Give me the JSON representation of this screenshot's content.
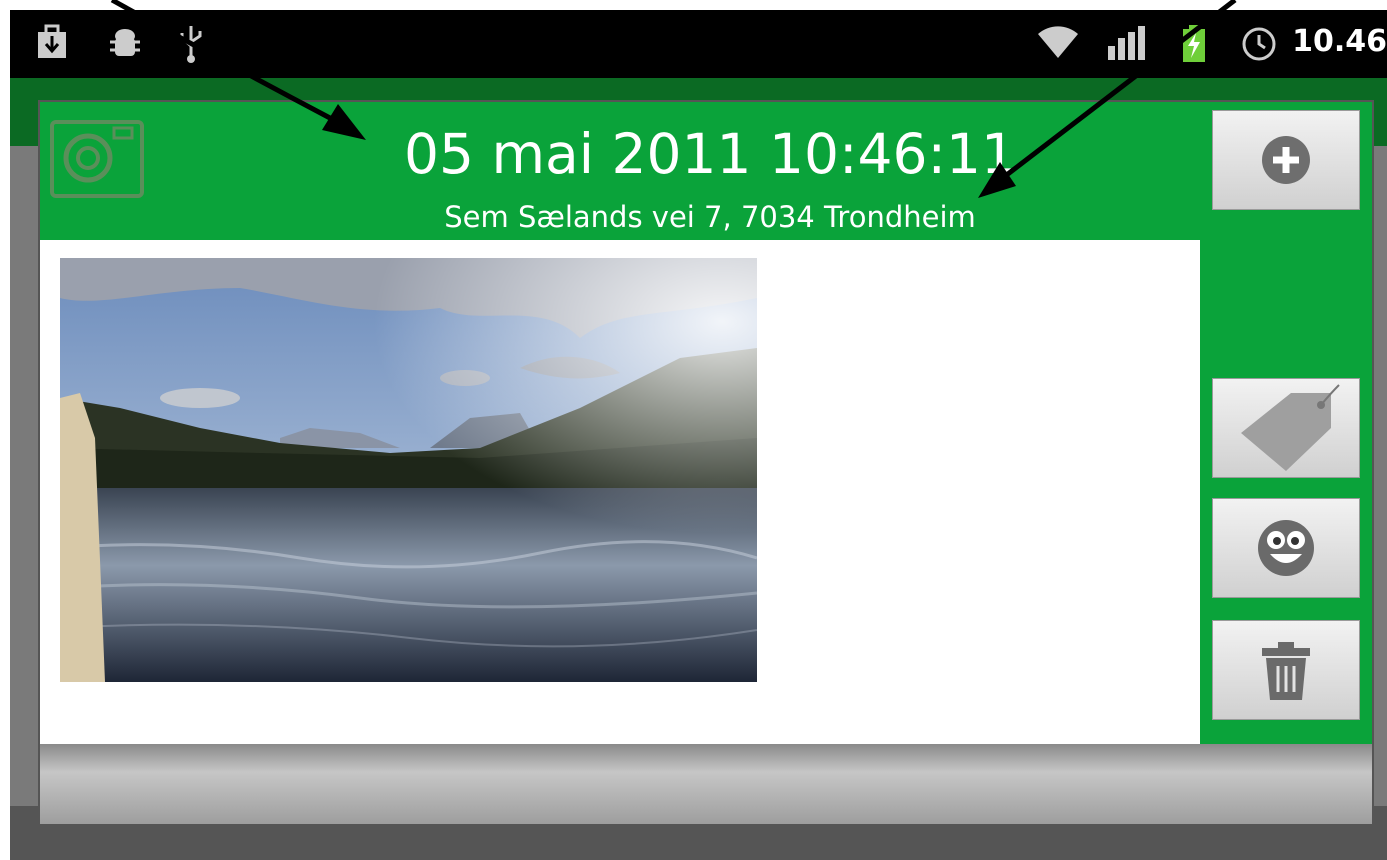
{
  "status_bar": {
    "time": "10.46",
    "left_icons": [
      "download-icon",
      "android-debug-icon",
      "usb-icon"
    ],
    "right_icons": [
      "wifi-icon",
      "signal-icon",
      "battery-charging-icon",
      "alarm-icon"
    ]
  },
  "dialog": {
    "title": "05 mai 2011 10:46:11",
    "subtitle": "Sem Sælands vei 7, 7034 Trondheim",
    "app_icon": "camera-app-icon",
    "photo": "lake-mountain-photo",
    "buttons": [
      {
        "name": "add-button",
        "icon": "plus-circle-icon"
      },
      {
        "name": "tag-button",
        "icon": "tag-icon"
      },
      {
        "name": "emotion-button",
        "icon": "smiley-icon"
      },
      {
        "name": "delete-button",
        "icon": "trash-icon"
      }
    ]
  },
  "colors": {
    "accent_green": "#0aa33a",
    "status_bar": "#000000"
  }
}
